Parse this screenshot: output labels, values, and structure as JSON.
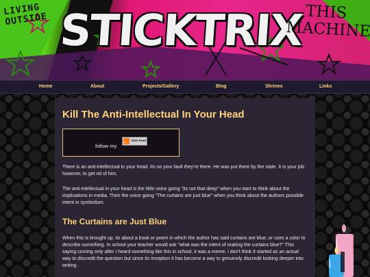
{
  "banner": {
    "tagline": "LIVING OUTSIDE",
    "site_title": "STICKTRIX",
    "tag2": "THIS MACHINE"
  },
  "nav": {
    "items": [
      "Home",
      "About",
      "Projects/Gallery",
      "Blog",
      "Shrines",
      "Links"
    ]
  },
  "post": {
    "title": "Kill The Anti-Intellectual In Your Head",
    "rss": {
      "follow_text": "follow my",
      "badge_text": "RSS Feed"
    },
    "paragraphs": [
      "There is an anti-intellectual in your head. Its no your fault they're there. He was put there by the state. It is your job however, to get rid of him.",
      "The anti-intellectual in your head is the little voice going \"its not that deep\" when you start to think about the implications in media. Their the voice going \"The curtains are just blue\" when you think about the authors possible intent in symbolism."
    ],
    "section_title": "The Curtains are Just Blue",
    "section_paragraph": "When this is brought up, its about a book or poem in which the author has said curtains are blue, or uses a color to describe something. In school your teacher would ask \"what was the intent of making the curtains blue?\" This saying coming only after I heard something like this in school, it was a meme, i don't think it started as an actual way to discredit the question but since its inception it has become a way to genuinely discredit looking deeper into writing."
  },
  "colors": {
    "accent": "#ffd27c",
    "panel_bg": "#2c2533",
    "nav_bg": "#1f1a2e",
    "banner_pink": "#e11874",
    "banner_green": "#5cd516"
  }
}
